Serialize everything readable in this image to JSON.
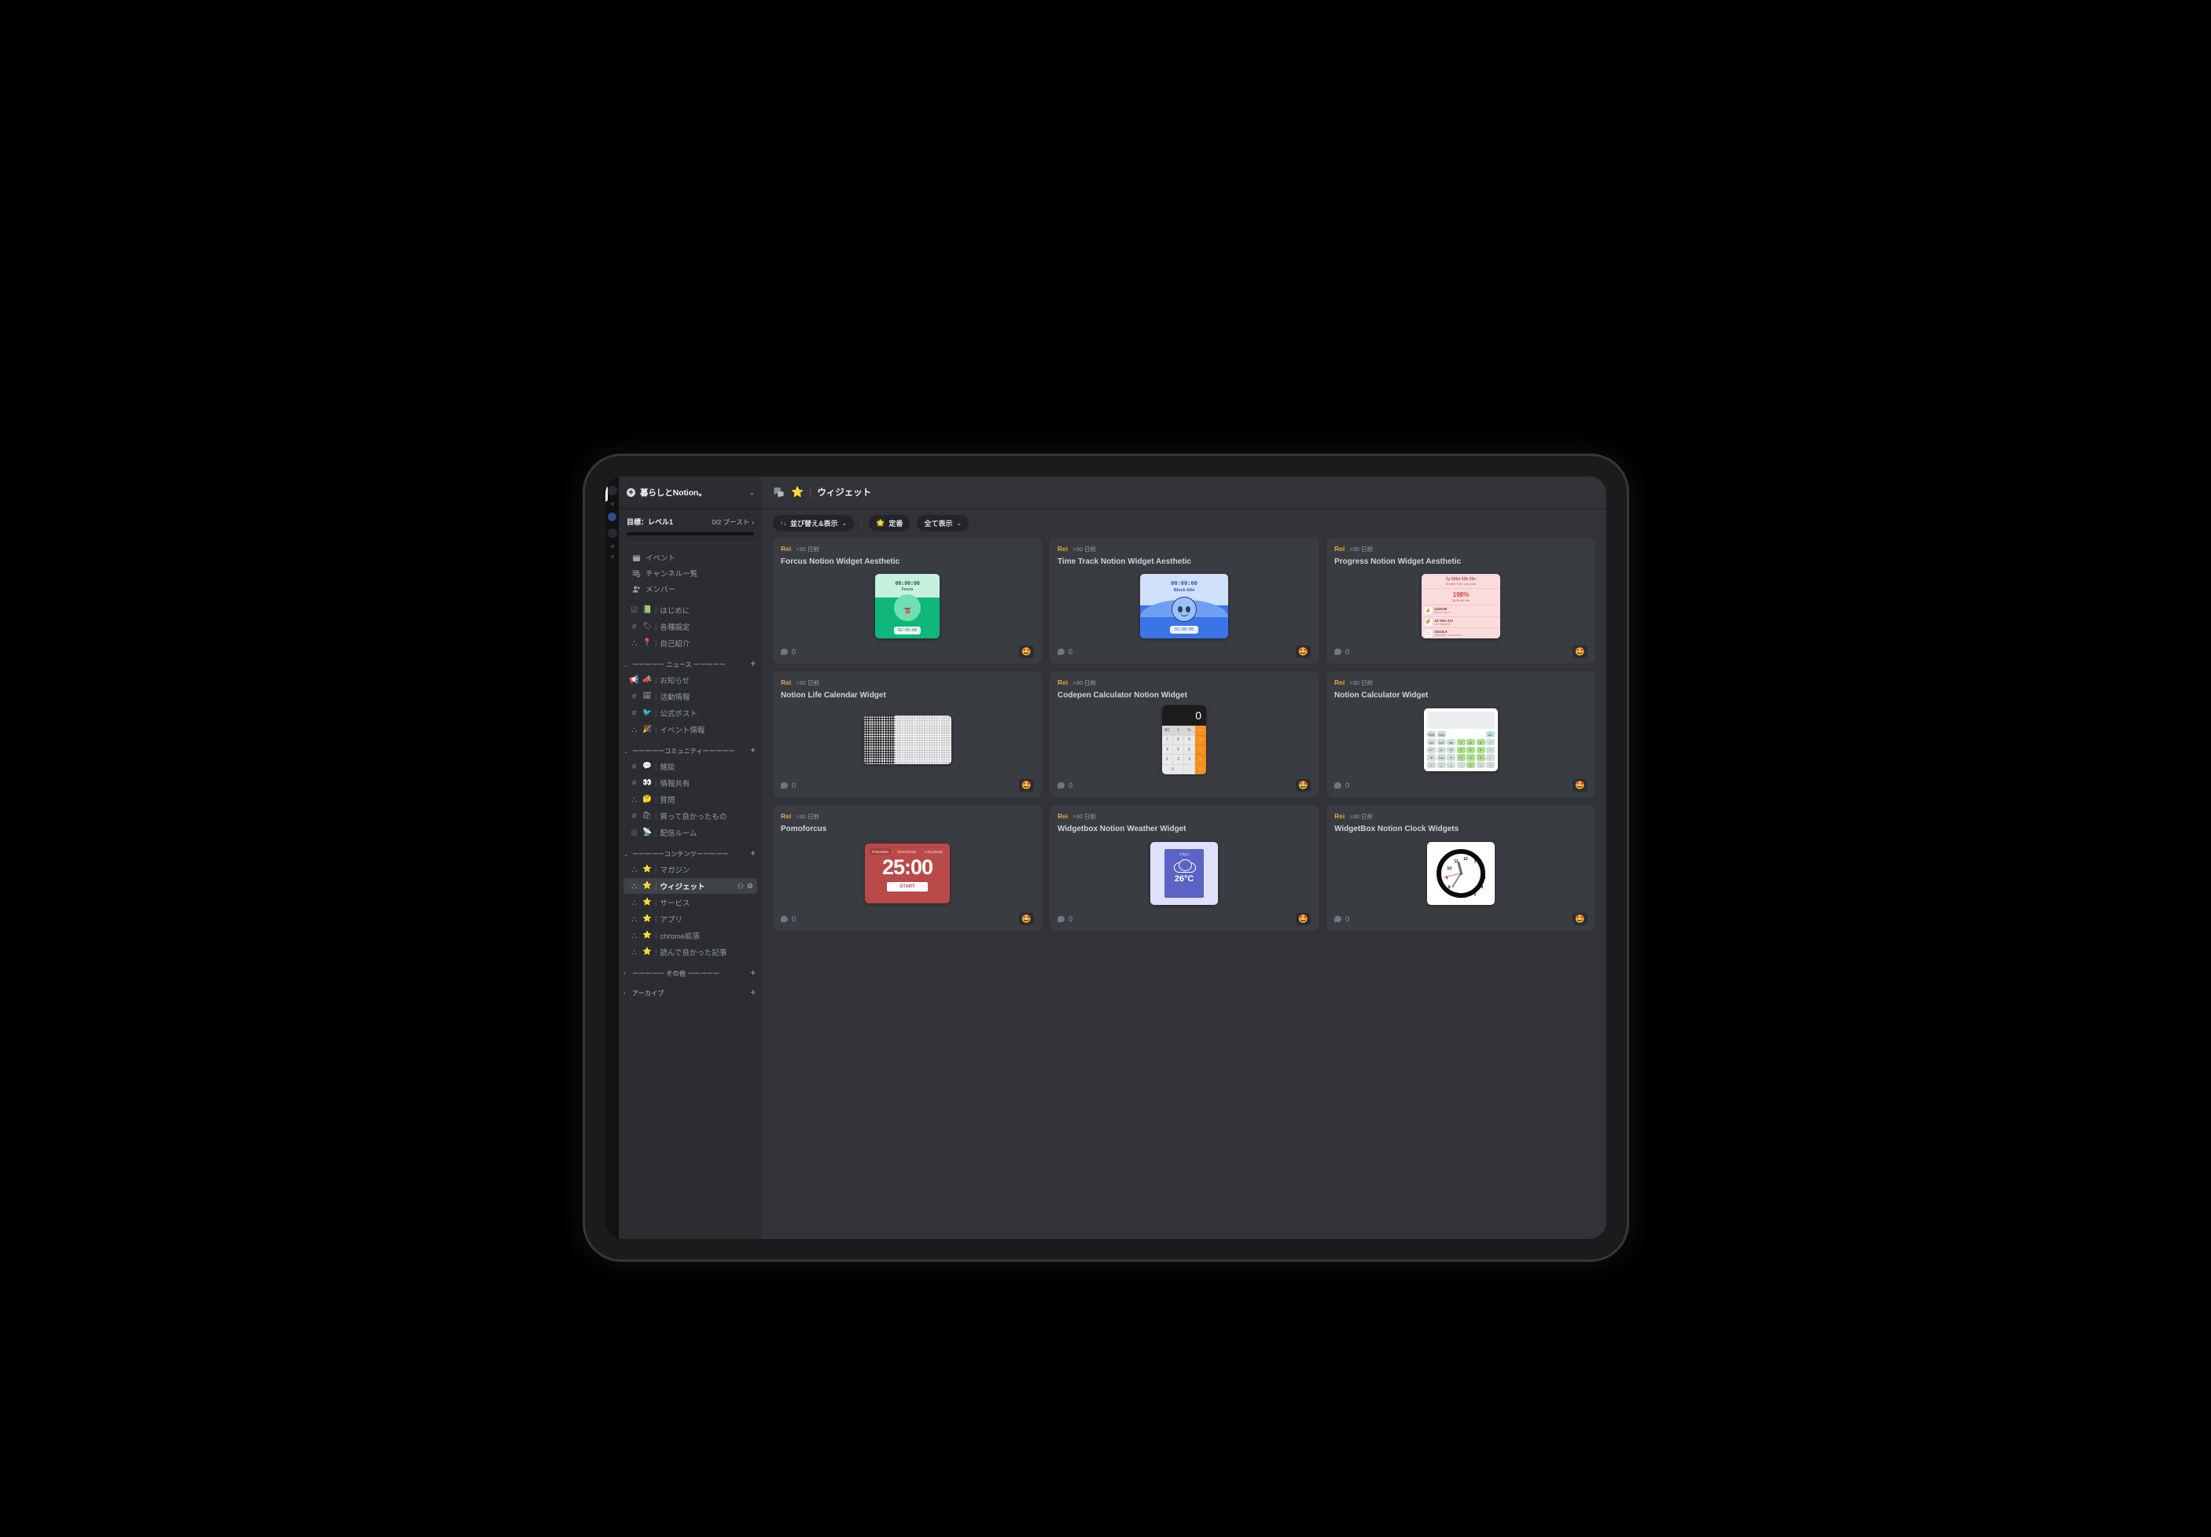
{
  "colors": {
    "bg": "#000000",
    "device_body": "#1b1b1d",
    "sidebar": "#2b2d31",
    "main": "#313338",
    "card": "#393c41",
    "accent_author": "#e8a33d",
    "active_channel": "#3f4248"
  },
  "rail": {
    "items": [
      {
        "name": "server-1",
        "style": "big"
      },
      {
        "name": "server-2",
        "style": "dot"
      },
      {
        "name": "server-3",
        "style": "blue"
      },
      {
        "name": "server-4",
        "style": "big"
      },
      {
        "name": "server-5",
        "style": "dot"
      },
      {
        "name": "server-6",
        "style": "dot"
      }
    ]
  },
  "sidebar": {
    "guild": {
      "name": "暮らしとNotion。",
      "badge_icon": "verified-icon",
      "chevron": "⌄"
    },
    "boost": {
      "goal_label": "目標：レベル1",
      "count_label": "0/2 ブースト",
      "chevron": "›"
    },
    "nav": [
      {
        "label": "イベント",
        "icon": "calendar-icon"
      },
      {
        "label": "チャンネル一覧",
        "icon": "channel-list-icon"
      },
      {
        "label": "メンバー",
        "icon": "members-icon"
      }
    ],
    "groups": [
      {
        "id": "intro",
        "label": "",
        "has_header": false,
        "channels": [
          {
            "type": "announcement",
            "type_glyph": "☑",
            "emoji": "📗",
            "name": "はじめに"
          },
          {
            "type": "text",
            "type_glyph": "#",
            "emoji": "🏷",
            "name": "各種設定"
          },
          {
            "type": "forum",
            "type_glyph": "⛬",
            "emoji": "📍",
            "name": "自己紹介"
          }
        ]
      },
      {
        "id": "news",
        "label": "ーーーーー ニュース ーーーーー",
        "has_header": true,
        "caret": "⌄",
        "plus": "+",
        "channels": [
          {
            "type": "announcement",
            "type_glyph": "📢",
            "emoji": "📣",
            "name": "お知らせ"
          },
          {
            "type": "text",
            "type_glyph": "#",
            "emoji": "🗓",
            "name": "活動情報"
          },
          {
            "type": "text",
            "type_glyph": "#",
            "emoji": "🐦",
            "name": "公式ポスト"
          },
          {
            "type": "forum",
            "type_glyph": "⛬",
            "emoji": "🎉",
            "name": "イベント情報"
          }
        ]
      },
      {
        "id": "community",
        "label": "ーーーーーコミュニティーーーーー",
        "has_header": true,
        "caret": "⌄",
        "plus": "+",
        "channels": [
          {
            "type": "text",
            "type_glyph": "#",
            "emoji": "💬",
            "name": "雑談"
          },
          {
            "type": "text",
            "type_glyph": "#",
            "emoji": "👀",
            "name": "情報共有"
          },
          {
            "type": "forum",
            "type_glyph": "⛬",
            "emoji": "🤔",
            "name": "質問"
          },
          {
            "type": "text",
            "type_glyph": "#",
            "emoji": "🛍",
            "name": "買って良かったもの"
          },
          {
            "type": "stage",
            "type_glyph": "◎",
            "emoji": "📡",
            "name": "配信ルーム"
          }
        ]
      },
      {
        "id": "contents",
        "label": "ーーーーーコンテンツーーーーー",
        "has_header": true,
        "caret": "⌄",
        "plus": "+",
        "channels": [
          {
            "type": "forum",
            "type_glyph": "⛬",
            "emoji": "⭐",
            "name": "マガジン"
          },
          {
            "type": "forum",
            "type_glyph": "⛬",
            "emoji": "⭐",
            "name": "ウィジェット",
            "active": true,
            "actions": [
              {
                "name": "invite-icon",
                "glyph": "⚇"
              },
              {
                "name": "settings-gear-icon",
                "glyph": "⚙"
              }
            ]
          },
          {
            "type": "forum",
            "type_glyph": "⛬",
            "emoji": "⭐",
            "name": "サービス"
          },
          {
            "type": "forum",
            "type_glyph": "⛬",
            "emoji": "⭐",
            "name": "アプリ"
          },
          {
            "type": "forum",
            "type_glyph": "⛬",
            "emoji": "⭐",
            "name": "chrome拡張"
          },
          {
            "type": "forum",
            "type_glyph": "⛬",
            "emoji": "⭐",
            "name": "読んで良かった記事"
          }
        ]
      },
      {
        "id": "other",
        "label": "ーーーーー その他 ーーーーー",
        "has_header": true,
        "caret": "›",
        "plus": "+",
        "channels": []
      },
      {
        "id": "archive",
        "label": "アーカイブ",
        "has_header": true,
        "caret": "›",
        "plus": "+",
        "channels": []
      }
    ]
  },
  "header": {
    "forum_icon": "forum-channel-icon",
    "emoji": "⭐",
    "separator": "|",
    "title": "ウィジェット"
  },
  "toolbar": {
    "sort": {
      "icon": "sort-icon",
      "glyph": "↑↓",
      "label": "並び替え&表示",
      "chevron": "⌄"
    },
    "tag": {
      "emoji": "🌟",
      "label": "定番"
    },
    "filter": {
      "label": "全て表示",
      "chevron": "⌄"
    }
  },
  "posts": [
    {
      "author": "Rei",
      "time": ">30 日前",
      "title": "Forcus Notion Widget Aesthetic",
      "comments": "0",
      "reaction": "🤩",
      "thumb": "focus",
      "thumb_data": {
        "timer": "00:00:00",
        "label": "Focus",
        "chip": "02:00:00"
      }
    },
    {
      "author": "Rei",
      "time": ">30 日前",
      "title": "Time Track Notion Widget Aesthetic",
      "comments": "0",
      "reaction": "🤩",
      "thumb": "timetrack",
      "thumb_data": {
        "timer": "00:00:00",
        "label": "Block title",
        "chip": "02:00:00"
      }
    },
    {
      "author": "Rei",
      "time": ">30 日前",
      "title": "Progress Notion Widget Aesthetic",
      "comments": "0",
      "reaction": "🤩",
      "thumb": "progress",
      "thumb_data": {
        "header": "1y 026d 03h 09s",
        "subheader": "Smoke Free one year",
        "percent": "198%",
        "percent_sub": "1y 0d 8h 4m",
        "rows": [
          {
            "icon": "💰",
            "value": "4348.86",
            "label": "Money saved"
          },
          {
            "icon": "🌈",
            "value": "1d 19m 21s",
            "label": "Life regained"
          },
          {
            "icon": "🚬",
            "value": "18116.8",
            "label": "Cigarettes not smoked"
          }
        ]
      }
    },
    {
      "author": "Rei",
      "time": ">30 日前",
      "title": "Notion Life Calendar Widget",
      "comments": "0",
      "reaction": "🤩",
      "thumb": "lifecal",
      "thumb_data": {}
    },
    {
      "author": "Rei",
      "time": ">30 日前",
      "title": "Codepen Calculator Notion Widget",
      "comments": "0",
      "reaction": "🤩",
      "thumb": "calc",
      "thumb_data": {
        "display": "0",
        "keys": [
          "AC",
          "±",
          "%",
          "÷",
          "7",
          "8",
          "9",
          "×",
          "4",
          "5",
          "6",
          "−",
          "1",
          "2",
          "3",
          "+",
          "0",
          ".",
          "="
        ]
      }
    },
    {
      "author": "Rei",
      "time": ">30 日前",
      "title": "Notion Calculator Widget",
      "comments": "0",
      "reaction": "🤩",
      "thumb": "scicalc",
      "thumb_data": {
        "keys_row1": [
          "Rad",
          "Deg",
          "",
          "",
          "",
          "",
          "AC"
        ],
        "keys_row2": [
          "sin",
          "cos",
          "tan",
          "7",
          "8",
          "9",
          "*"
        ],
        "keys_row3": [
          "x^",
          "pi",
          "%",
          "4",
          "5",
          "6",
          "/"
        ],
        "keys_row4": [
          "ln",
          "log",
          "x!",
          "1",
          "2",
          "3",
          "-"
        ],
        "keys_row5": [
          "√",
          "(",
          ")",
          ".",
          "0",
          "=",
          "+"
        ]
      }
    },
    {
      "author": "Rei",
      "time": ">30 日前",
      "title": "Pomoforcus",
      "comments": "0",
      "reaction": "🤩",
      "thumb": "pomo",
      "thumb_data": {
        "tabs": [
          "Pomodoro",
          "Short Break",
          "Long Break"
        ],
        "time": "25:00",
        "start": "START"
      }
    },
    {
      "author": "Rei",
      "time": ">30 日前",
      "title": "Widgetbox Notion Weather Widget",
      "comments": "0",
      "reaction": "🤩",
      "thumb": "weather",
      "thumb_data": {
        "city": "Tokyo",
        "icon": "cloud-icon",
        "temp": "26°C"
      }
    },
    {
      "author": "Rei",
      "time": ">30 日前",
      "title": "WidgetBox Notion Clock Widgets",
      "comments": "0",
      "reaction": "🤩",
      "thumb": "clock",
      "thumb_data": {
        "numbers": [
          "12",
          "1",
          "2",
          "3",
          "4",
          "5",
          "6",
          "7",
          "8",
          "9",
          "10",
          "11"
        ]
      }
    }
  ]
}
